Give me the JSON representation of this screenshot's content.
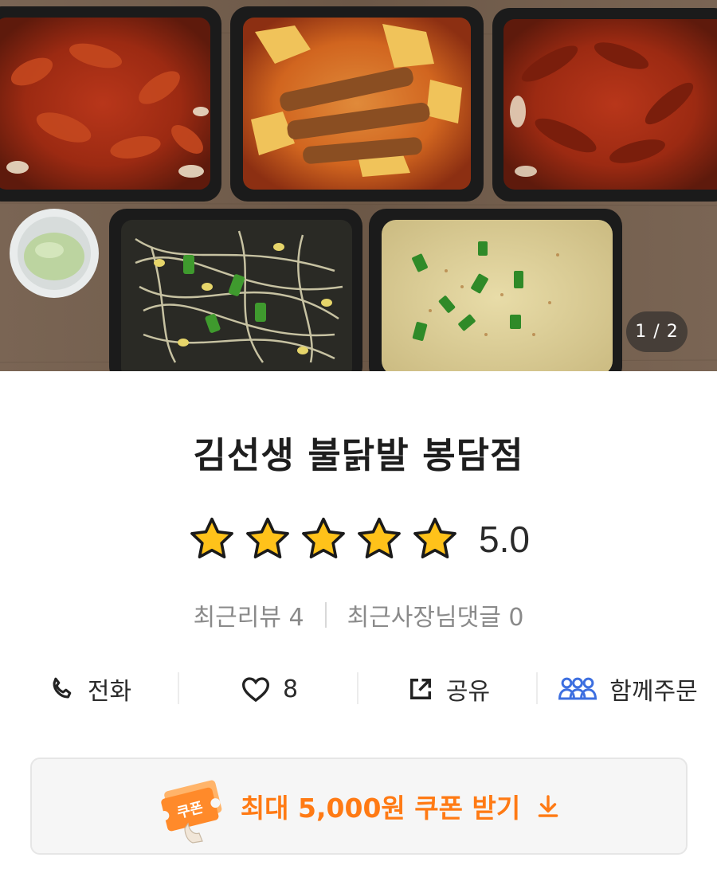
{
  "hero": {
    "page_indicator": "1 / 2"
  },
  "store": {
    "name": "김선생 불닭발 봉담점",
    "rating": "5.0",
    "stars_filled": 5,
    "stars_total": 5
  },
  "reviews": {
    "recent_reviews": "최근리뷰 4",
    "recent_owner_replies": "최근사장님댓글 0"
  },
  "actions": [
    {
      "label": "전화",
      "icon": "phone-icon"
    },
    {
      "label": "8",
      "icon": "heart-icon"
    },
    {
      "label": "공유",
      "icon": "share-icon"
    },
    {
      "label": "함께주문",
      "icon": "group-order-icon"
    }
  ],
  "coupon": {
    "label": "최대 5,000원 쿠폰 받기",
    "badge_text": "쿠폰",
    "icon": "download-arrow-icon"
  },
  "colors": {
    "accent_orange": "#ff7a14",
    "star_yellow": "#ffc21a",
    "group_icon_blue": "#3d6fe0"
  }
}
